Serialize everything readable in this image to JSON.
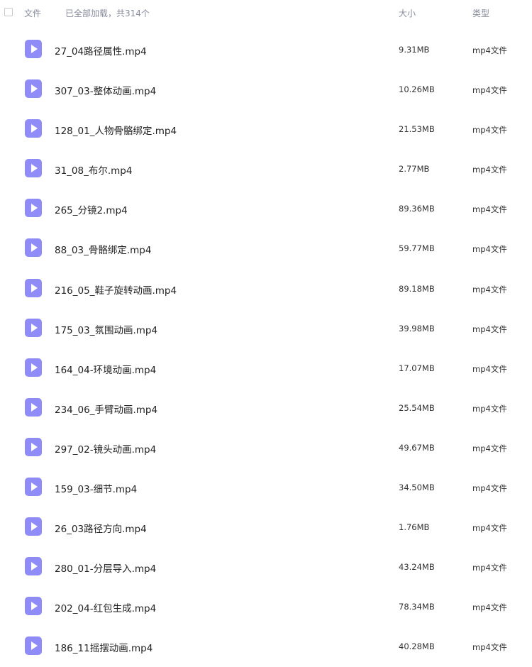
{
  "header": {
    "file_label": "文件",
    "loaded_text": "已全部加载，共314个",
    "size_label": "大小",
    "type_label": "类型"
  },
  "files": [
    {
      "name": "27_04路径属性.mp4",
      "size": "9.31MB",
      "type": "mp4文件"
    },
    {
      "name": "307_03-整体动画.mp4",
      "size": "10.26MB",
      "type": "mp4文件"
    },
    {
      "name": "128_01_人物骨骼绑定.mp4",
      "size": "21.53MB",
      "type": "mp4文件"
    },
    {
      "name": "31_08_布尔.mp4",
      "size": "2.77MB",
      "type": "mp4文件"
    },
    {
      "name": "265_分镜2.mp4",
      "size": "89.36MB",
      "type": "mp4文件"
    },
    {
      "name": "88_03_骨骼绑定.mp4",
      "size": "59.77MB",
      "type": "mp4文件"
    },
    {
      "name": "216_05_鞋子旋转动画.mp4",
      "size": "89.18MB",
      "type": "mp4文件"
    },
    {
      "name": "175_03_氛围动画.mp4",
      "size": "39.98MB",
      "type": "mp4文件"
    },
    {
      "name": "164_04-环境动画.mp4",
      "size": "17.07MB",
      "type": "mp4文件"
    },
    {
      "name": "234_06_手臂动画.mp4",
      "size": "25.54MB",
      "type": "mp4文件"
    },
    {
      "name": "297_02-镜头动画.mp4",
      "size": "49.67MB",
      "type": "mp4文件"
    },
    {
      "name": "159_03-细节.mp4",
      "size": "34.50MB",
      "type": "mp4文件"
    },
    {
      "name": "26_03路径方向.mp4",
      "size": "1.76MB",
      "type": "mp4文件"
    },
    {
      "name": "280_01-分层导入.mp4",
      "size": "43.24MB",
      "type": "mp4文件"
    },
    {
      "name": "202_04-红包生成.mp4",
      "size": "78.34MB",
      "type": "mp4文件"
    },
    {
      "name": "186_11摇摆动画.mp4",
      "size": "40.28MB",
      "type": "mp4文件"
    }
  ],
  "colors": {
    "icon": "#8f8cf8",
    "header_text": "#878c9c"
  },
  "icons": {
    "file": "video-file-icon",
    "select_all": "checkbox-icon"
  }
}
